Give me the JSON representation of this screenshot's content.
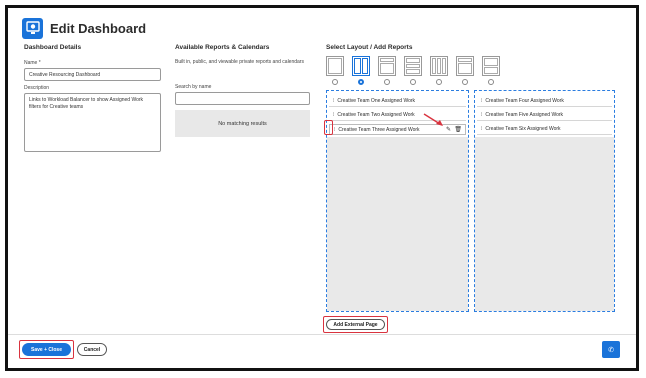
{
  "header": {
    "title": "Edit Dashboard",
    "icon": "dashboard-icon"
  },
  "details": {
    "section_title": "Dashboard Details",
    "name_label": "Name *",
    "name_value": "Creative Resourcing Dashboard",
    "description_label": "Description",
    "description_value": "Links to Workload Balancer to show Assigned Work filters for Creative teams"
  },
  "reports": {
    "section_title": "Available Reports & Calendars",
    "subtitle": "Built in, public, and viewable private reports and calendars",
    "search_label": "Search by name",
    "search_value": "",
    "no_results": "No matching results"
  },
  "layout": {
    "section_title": "Select Layout / Add Reports",
    "selected_index": 1,
    "options": 7,
    "left_column": [
      "Creative Team One Assigned Work",
      "Creative Team Two Assigned Work",
      "Creative Team Three Assigned Work"
    ],
    "right_column": [
      "Creative Team Four Assigned Work",
      "Creative Team Five Assigned Work",
      "Creative Team Six Assigned Work"
    ],
    "add_external_label": "Add External Page"
  },
  "footer": {
    "save_label": "Save + Close",
    "cancel_label": "Cancel"
  },
  "colors": {
    "accent": "#1a73d9",
    "highlight": "#d9333f"
  }
}
